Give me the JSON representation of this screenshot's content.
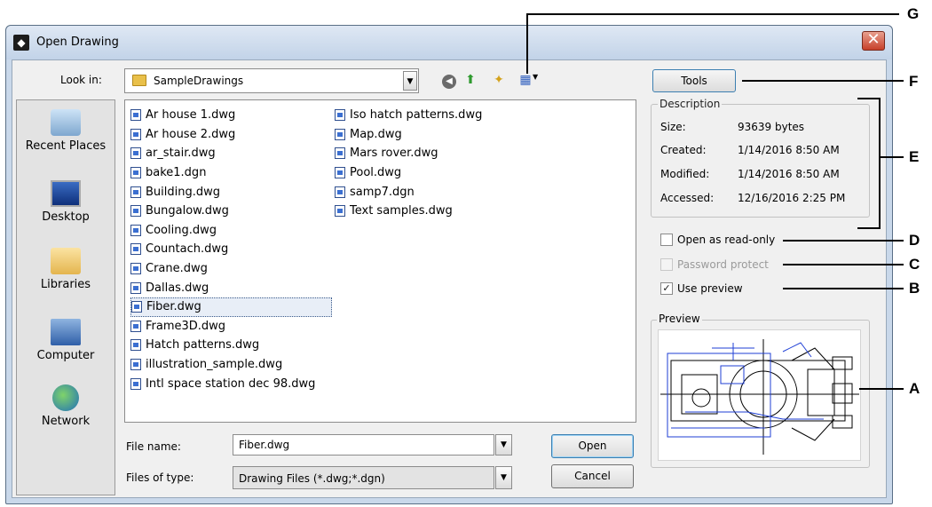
{
  "window": {
    "title": "Open Drawing",
    "close_glyph": "✕"
  },
  "look_in": {
    "label": "Look in:",
    "value": "SampleDrawings"
  },
  "places": [
    {
      "label": "Recent Places",
      "icon": "recent-places-icon"
    },
    {
      "label": "Desktop",
      "icon": "desktop-icon"
    },
    {
      "label": "Libraries",
      "icon": "libraries-icon"
    },
    {
      "label": "Computer",
      "icon": "computer-icon"
    },
    {
      "label": "Network",
      "icon": "network-icon"
    }
  ],
  "files": {
    "column1": [
      "Ar house 1.dwg",
      "Ar house 2.dwg",
      "ar_stair.dwg",
      "bake1.dgn",
      "Building.dwg",
      "Bungalow.dwg",
      "Cooling.dwg",
      "Countach.dwg",
      "Crane.dwg",
      "Dallas.dwg",
      "Fiber.dwg",
      "Frame3D.dwg",
      "Hatch patterns.dwg",
      "illustration_sample.dwg",
      "Intl space station dec 98.dwg"
    ],
    "column2": [
      "Iso hatch patterns.dwg",
      "Map.dwg",
      "Mars rover.dwg",
      "Pool.dwg",
      "samp7.dgn",
      "Text samples.dwg"
    ],
    "selected": "Fiber.dwg"
  },
  "file_name": {
    "label": "File name:",
    "value": "Fiber.dwg"
  },
  "file_type": {
    "label": "Files of type:",
    "value": "Drawing Files (*.dwg;*.dgn)"
  },
  "buttons": {
    "open": "Open",
    "cancel": "Cancel",
    "tools": "Tools"
  },
  "description": {
    "title": "Description",
    "rows": [
      {
        "label": "Size:",
        "value": "93639 bytes"
      },
      {
        "label": "Created:",
        "value": "1/14/2016 8:50 AM"
      },
      {
        "label": "Modified:",
        "value": "1/14/2016 8:50 AM"
      },
      {
        "label": "Accessed:",
        "value": "12/16/2016 2:25 PM"
      }
    ]
  },
  "options": {
    "read_only": {
      "label": "Open as read-only",
      "checked": false
    },
    "password": {
      "label": "Password protect",
      "checked": false,
      "disabled": true
    },
    "use_preview": {
      "label": "Use preview",
      "checked": true,
      "check_glyph": "✓"
    }
  },
  "preview": {
    "title": "Preview"
  },
  "callouts": [
    "G",
    "F",
    "E",
    "D",
    "C",
    "B",
    "A"
  ]
}
